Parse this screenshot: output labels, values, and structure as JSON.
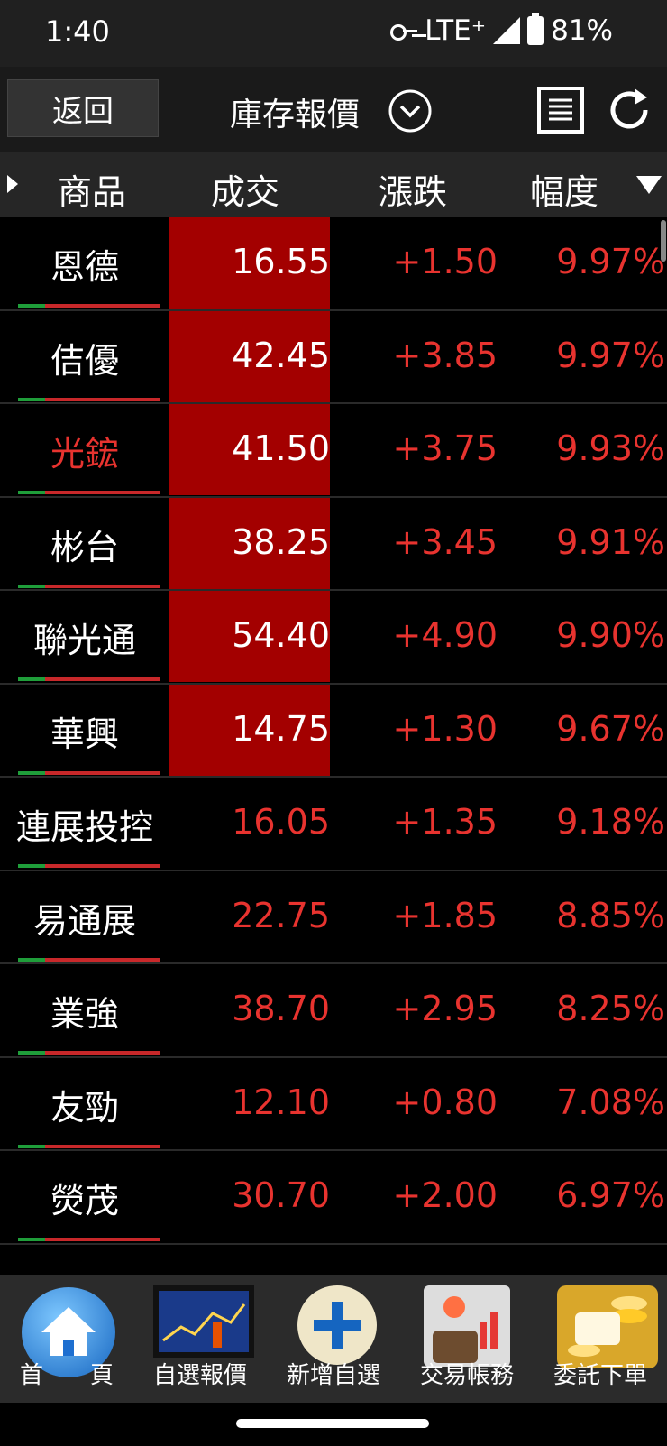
{
  "status": {
    "time": "1:40",
    "network": "LTE⁺",
    "battery": "81%"
  },
  "header": {
    "back_label": "返回",
    "title": "庫存報價"
  },
  "columns": {
    "product": "商品",
    "price": "成交",
    "change": "漲跌",
    "pct": "幅度"
  },
  "rows": [
    {
      "name": "恩德",
      "price": "16.55",
      "change": "+1.50",
      "pct": "9.97%",
      "limit_up": true,
      "name_red": false
    },
    {
      "name": "佶優",
      "price": "42.45",
      "change": "+3.85",
      "pct": "9.97%",
      "limit_up": true,
      "name_red": false
    },
    {
      "name": "光鋐",
      "price": "41.50",
      "change": "+3.75",
      "pct": "9.93%",
      "limit_up": true,
      "name_red": true
    },
    {
      "name": "彬台",
      "price": "38.25",
      "change": "+3.45",
      "pct": "9.91%",
      "limit_up": true,
      "name_red": false
    },
    {
      "name": "聯光通",
      "price": "54.40",
      "change": "+4.90",
      "pct": "9.90%",
      "limit_up": true,
      "name_red": false
    },
    {
      "name": "華興",
      "price": "14.75",
      "change": "+1.30",
      "pct": "9.67%",
      "limit_up": true,
      "name_red": false
    },
    {
      "name": "連展投控",
      "price": "16.05",
      "change": "+1.35",
      "pct": "9.18%",
      "limit_up": false,
      "name_red": false
    },
    {
      "name": "易通展",
      "price": "22.75",
      "change": "+1.85",
      "pct": "8.85%",
      "limit_up": false,
      "name_red": false
    },
    {
      "name": "業強",
      "price": "38.70",
      "change": "+2.95",
      "pct": "8.25%",
      "limit_up": false,
      "name_red": false
    },
    {
      "name": "友勁",
      "price": "12.10",
      "change": "+0.80",
      "pct": "7.08%",
      "limit_up": false,
      "name_red": false
    },
    {
      "name": "熒茂",
      "price": "30.70",
      "change": "+2.00",
      "pct": "6.97%",
      "limit_up": false,
      "name_red": false
    }
  ],
  "nav": [
    {
      "label": "首　　頁",
      "icon": "home-icon"
    },
    {
      "label": "自選報價",
      "icon": "chart-tablet-icon"
    },
    {
      "label": "新增自選",
      "icon": "plus-icon"
    },
    {
      "label": "交易帳務",
      "icon": "wallet-chart-icon"
    },
    {
      "label": "委託下單",
      "icon": "gold-coins-icon"
    }
  ],
  "colors": {
    "up_red": "#e8332f",
    "limit_bg": "#a30000",
    "bar_green": "#1f9e3a"
  }
}
